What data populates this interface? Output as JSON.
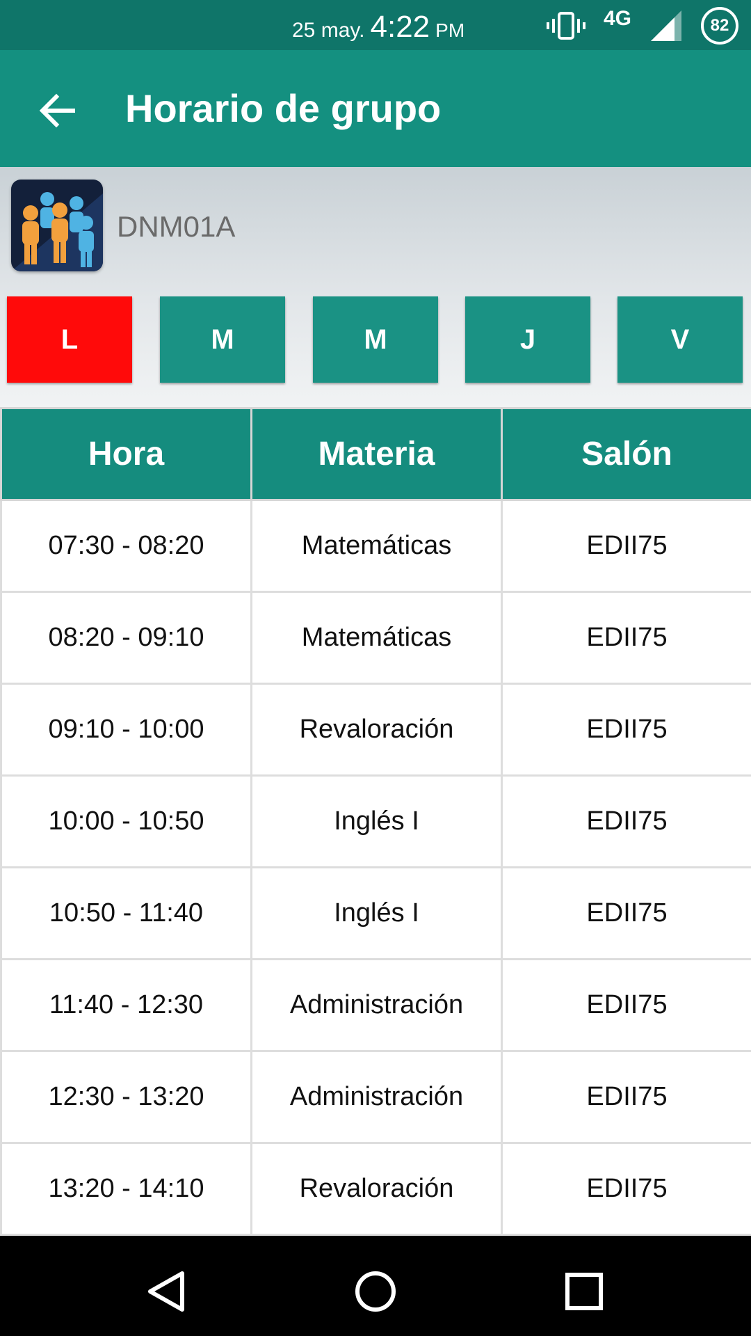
{
  "status_bar": {
    "date": "25 may.",
    "time": "4:22",
    "ampm": "PM",
    "network": "4G",
    "battery": "82",
    "icons": [
      "vibrate-icon",
      "signal-icon",
      "battery-icon"
    ]
  },
  "app_bar": {
    "title": "Horario de grupo",
    "back_icon": "arrow-back-icon"
  },
  "group": {
    "name": "DNM01A",
    "avatar_icon": "group-people-icon"
  },
  "days": [
    {
      "label": "L",
      "active": true
    },
    {
      "label": "M",
      "active": false
    },
    {
      "label": "M",
      "active": false
    },
    {
      "label": "J",
      "active": false
    },
    {
      "label": "V",
      "active": false
    }
  ],
  "table": {
    "headers": [
      "Hora",
      "Materia",
      "Salón"
    ],
    "rows": [
      [
        "07:30 - 08:20",
        "Matemáticas",
        "EDII75"
      ],
      [
        "08:20 - 09:10",
        "Matemáticas",
        "EDII75"
      ],
      [
        "09:10 - 10:00",
        "Revaloración",
        "EDII75"
      ],
      [
        "10:00 - 10:50",
        "Inglés I",
        "EDII75"
      ],
      [
        "10:50 - 11:40",
        "Inglés I",
        "EDII75"
      ],
      [
        "11:40 - 12:30",
        "Administración",
        "EDII75"
      ],
      [
        "12:30 - 13:20",
        "Administración",
        "EDII75"
      ],
      [
        "13:20 - 14:10",
        "Revaloración",
        "EDII75"
      ]
    ]
  },
  "colors": {
    "status_bar": "#0f7569",
    "app_bar": "#149080",
    "day_tab": "#1a9284",
    "day_tab_active": "#ff0a0a",
    "table_header": "#158c7e"
  },
  "nav_bar": {
    "icons": [
      "back-triangle-icon",
      "home-circle-icon",
      "recents-square-icon"
    ]
  }
}
